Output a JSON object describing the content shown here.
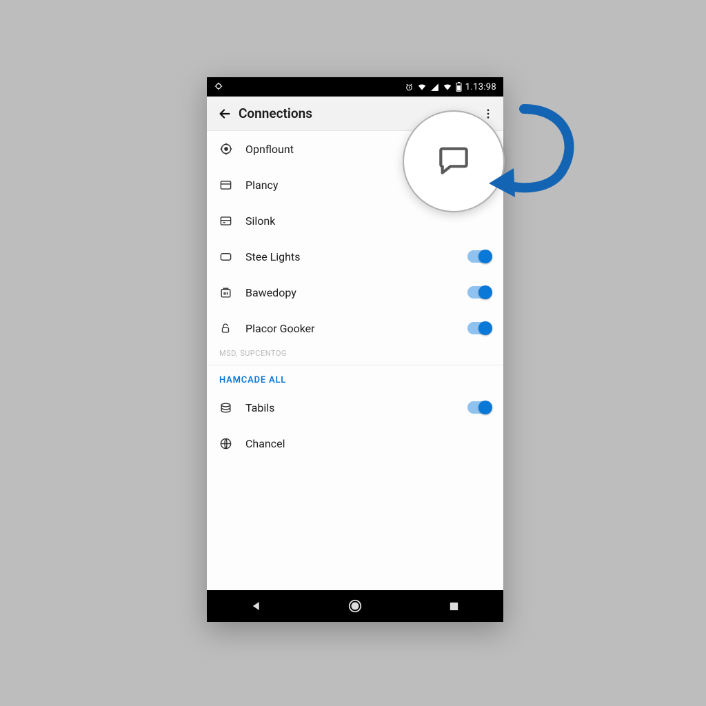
{
  "statusbar": {
    "time": "1.13:98"
  },
  "appbar": {
    "title": "Connections"
  },
  "section1": {
    "items": [
      {
        "label": "Opnflount",
        "icon": "target",
        "toggle": null
      },
      {
        "label": "Plancy",
        "icon": "panel",
        "toggle": null
      },
      {
        "label": "Silonk",
        "icon": "card",
        "toggle": null
      },
      {
        "label": "Stee Lights",
        "icon": "rect",
        "toggle": true
      },
      {
        "label": "Bawedopy",
        "icon": "container",
        "toggle": true
      },
      {
        "label": "Placor Gooker",
        "icon": "lock",
        "toggle": true
      }
    ],
    "caption": "MSD, SUPCENTOG"
  },
  "section2": {
    "header": "HAMCADE ALL",
    "items": [
      {
        "label": "Tabils",
        "icon": "disk",
        "toggle": true
      },
      {
        "label": "Chancel",
        "icon": "globe",
        "toggle": null
      }
    ]
  },
  "callout": {
    "icon": "chat"
  }
}
